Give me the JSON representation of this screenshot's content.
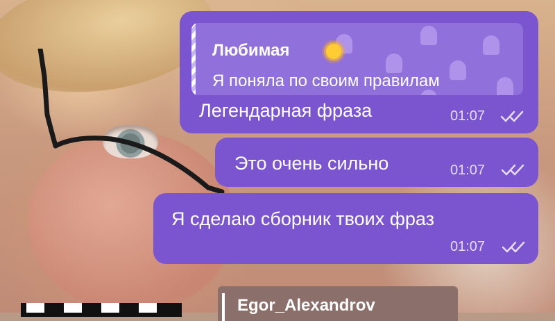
{
  "chat": {
    "reply": {
      "author": "Любимая",
      "emoji": "sun-icon",
      "text": "Я поняла по своим правилам"
    },
    "messages": [
      {
        "text": "Легендарная фраза",
        "time": "01:07",
        "status": "read"
      },
      {
        "text": "Это очень сильно",
        "time": "01:07",
        "status": "read"
      },
      {
        "text": "Я сделаю сборник твоих фраз",
        "time": "01:07",
        "status": "read"
      }
    ],
    "next_message": {
      "author": "Egor_Alexandrov"
    }
  },
  "colors": {
    "bubble": "#7b55cf",
    "reply_block": "#9070da",
    "text": "#ffffff",
    "meta": "#e7ddfa"
  }
}
